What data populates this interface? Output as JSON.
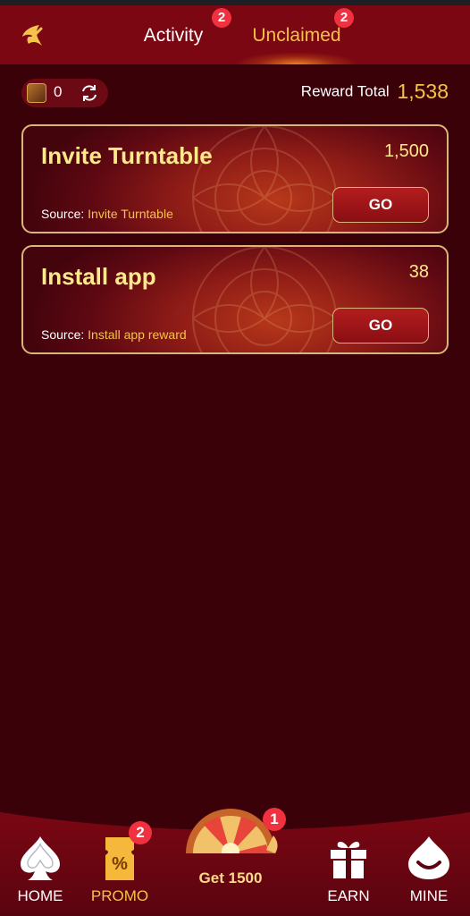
{
  "header": {
    "tabs": [
      {
        "label": "Activity",
        "badge": "2",
        "active": false
      },
      {
        "label": "Unclaimed",
        "badge": "2",
        "active": true
      }
    ]
  },
  "balance": {
    "value": "0"
  },
  "reward_total": {
    "label": "Reward Total",
    "value": "1,538"
  },
  "rewards": [
    {
      "title": "Invite Turntable",
      "amount": "1,500",
      "source_label": "Source: ",
      "source": "Invite Turntable",
      "button": "GO"
    },
    {
      "title": "Install app",
      "amount": "38",
      "source_label": "Source: ",
      "source": "Install app reward",
      "button": "GO"
    }
  ],
  "nav": {
    "home": "HOME",
    "promo": "PROMO",
    "promo_badge": "2",
    "center": "Get 1500",
    "center_badge": "1",
    "earn": "EARN",
    "mine": "MINE"
  },
  "colors": {
    "background": "#3a0208",
    "header": "#7a0712",
    "accent_gold": "#f5c24a",
    "badge": "#f0313f"
  },
  "icons": [
    "back-icon",
    "coin-icon",
    "refresh-icon",
    "spade-icon",
    "coupon-icon",
    "wheel-icon",
    "gift-icon",
    "mine-icon"
  ]
}
